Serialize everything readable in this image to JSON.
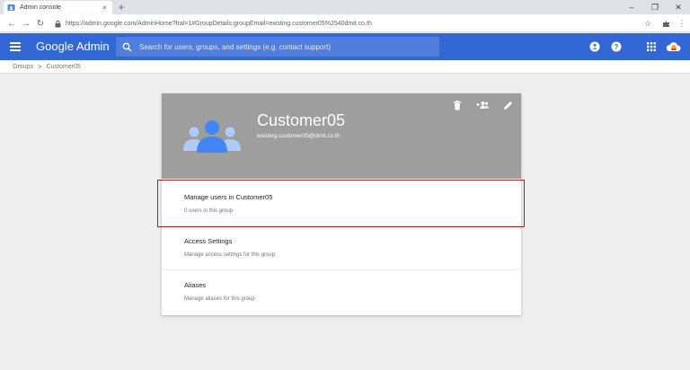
{
  "browser": {
    "tab_title": "Admin console",
    "tab_close": "×",
    "new_tab": "+",
    "url": "https://admin.google.com/AdminHome?fral=1#GroupDetails:groupEmail=existing.customer05%2540dmit.co.th",
    "window_controls": [
      "–",
      "❐",
      "✕"
    ]
  },
  "header": {
    "brand": "Google Admin",
    "search_placeholder": "Search for users, groups, and settings (e.g. contact support)"
  },
  "breadcrumb": {
    "parent": "Groups",
    "separator": ">",
    "current": "Customer05"
  },
  "group": {
    "name": "Customer05",
    "email": "existing.customer05@dmit.co.th"
  },
  "sections": [
    {
      "title": "Manage users in Customer05",
      "subtitle": "0 users in this group"
    },
    {
      "title": "Access Settings",
      "subtitle": "Manage access settings for this group"
    },
    {
      "title": "Aliases",
      "subtitle": "Manage aliases for this group"
    }
  ],
  "colors": {
    "appbar": "#3367d6",
    "card_header": "#9e9e9e",
    "group_icon": "#4285f4",
    "highlight": "#b71c1c"
  },
  "icons": [
    "admin-favicon",
    "lock-icon",
    "menu-icon",
    "search-icon",
    "help-icon",
    "apps-icon",
    "delete-icon",
    "add-member-icon",
    "edit-icon"
  ]
}
